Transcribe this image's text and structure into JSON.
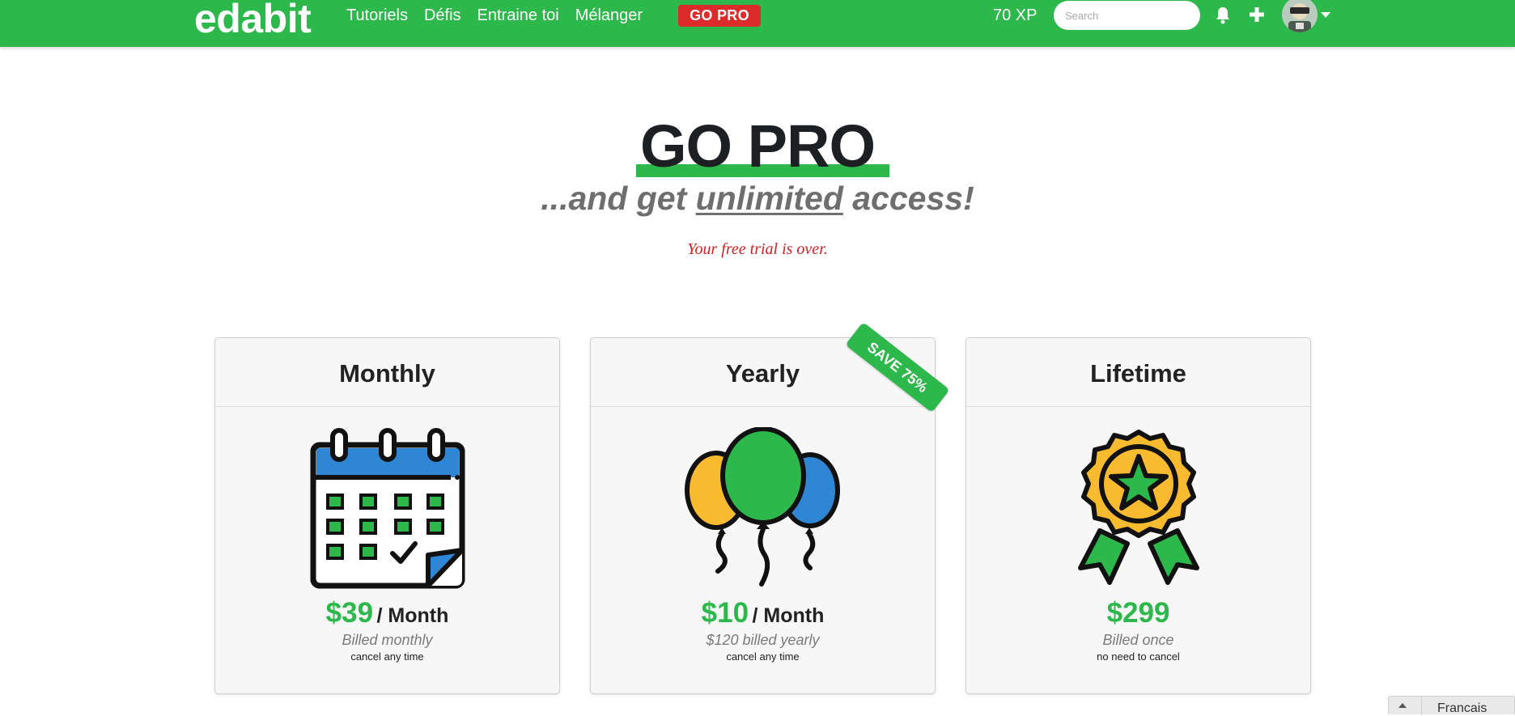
{
  "navbar": {
    "brand": "edabit",
    "links": [
      "Tutoriels",
      "Défis",
      "Entraine toi",
      "Mélanger"
    ],
    "go_pro": "GO PRO",
    "xp": "70 XP",
    "search_placeholder": "Search",
    "icons": [
      "bell-icon",
      "plus-icon",
      "avatar",
      "caret-down-icon"
    ],
    "colors": {
      "bar": "#2cb84a",
      "go_pro_pill": "#dd2b2b"
    }
  },
  "hero": {
    "title": "GO PRO",
    "subtitle_pre": "...and get ",
    "subtitle_emph": "unlimited",
    "subtitle_post": " access!",
    "trial_notice": "Your free trial is over."
  },
  "plans": [
    {
      "name": "Monthly",
      "icon": "calendar-icon",
      "price": "$39",
      "per": "/ Month",
      "billed": "Billed monthly",
      "note": "cancel any time"
    },
    {
      "name": "Yearly",
      "icon": "balloons-icon",
      "price": "$10",
      "per": "/ Month",
      "billed": "$120 billed yearly",
      "note": "cancel any time",
      "badge": "SAVE 75%"
    },
    {
      "name": "Lifetime",
      "icon": "award-ribbon-icon",
      "price": "$299",
      "per": "",
      "billed": "Billed once",
      "note": "no need to cancel"
    }
  ],
  "footer": {
    "language": "Francais"
  },
  "colors": {
    "accent": "#2cb84a",
    "alert": "#cc2222",
    "blue": "#2e86d4",
    "yellow": "#f8bb2f"
  }
}
